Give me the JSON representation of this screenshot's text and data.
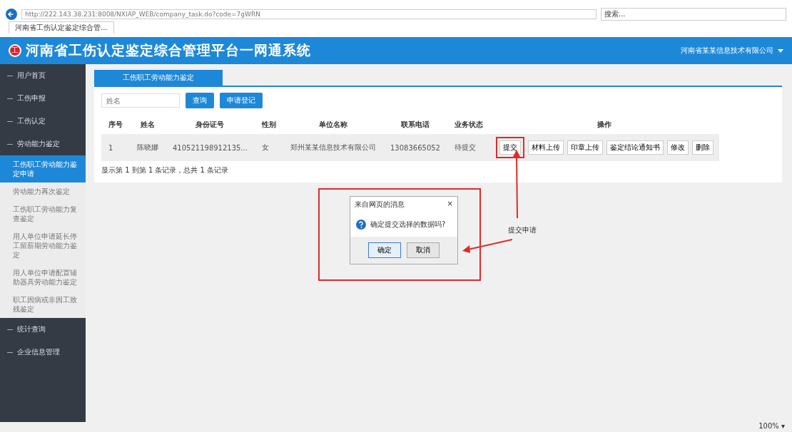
{
  "browser": {
    "address": "http://222.143.38.231:8008/NXIAP_WEB/company_task.do?code=7gWRN",
    "search_placeholder": "搜索...",
    "tab_title": "河南省工伤认定鉴定综合管...",
    "zoom": "100% ▾"
  },
  "header": {
    "logo": "工",
    "title": "河南省工伤认定鉴定综合管理平台一网通系统",
    "user": "河南省某某信息技术有限公司"
  },
  "sidebar": {
    "items": [
      {
        "label": "用户首页"
      },
      {
        "label": "工伤申报"
      },
      {
        "label": "工伤认定"
      },
      {
        "label": "劳动能力鉴定",
        "children": [
          {
            "label": "工伤职工劳动能力鉴定申请",
            "selected": true
          },
          {
            "label": "劳动能力再次鉴定",
            "selected": false
          },
          {
            "label": "工伤职工劳动能力复查鉴定",
            "selected": false
          },
          {
            "label": "用人单位申请延长停工留薪期劳动能力鉴定",
            "selected": false
          },
          {
            "label": "用人单位申请配置辅助器具劳动能力鉴定",
            "selected": false
          },
          {
            "label": "职工因病或非因工致残鉴定",
            "selected": false
          }
        ]
      },
      {
        "label": "统计查询"
      },
      {
        "label": "企业信息管理"
      }
    ]
  },
  "tab": {
    "label": "工伤职工劳动能力鉴定"
  },
  "search": {
    "placeholder": "姓名"
  },
  "toolbar": [
    "查询",
    "申请登记"
  ],
  "table": {
    "columns": [
      "序号",
      "姓名",
      "身份证号",
      "性别",
      "单位名称",
      "联系电话",
      "业务状态",
      "操作"
    ],
    "rows": [
      {
        "cells": [
          "1",
          "陈晓娜",
          "410521198912135...",
          "女",
          "郑州某某信息技术有限公司",
          "13083665052",
          "待提交"
        ],
        "actions": [
          "提交",
          "材料上传",
          "印章上传",
          "鉴定结论通知书",
          "修改",
          "删除"
        ]
      }
    ]
  },
  "pagination": "显示第 1 到第 1 条记录，总共 1 条记录",
  "dialog": {
    "title": "来自网页的消息",
    "close": "×",
    "message": "确定提交选择的数据吗?",
    "buttons": [
      "确定",
      "取消"
    ]
  },
  "annotation": "提交申请"
}
